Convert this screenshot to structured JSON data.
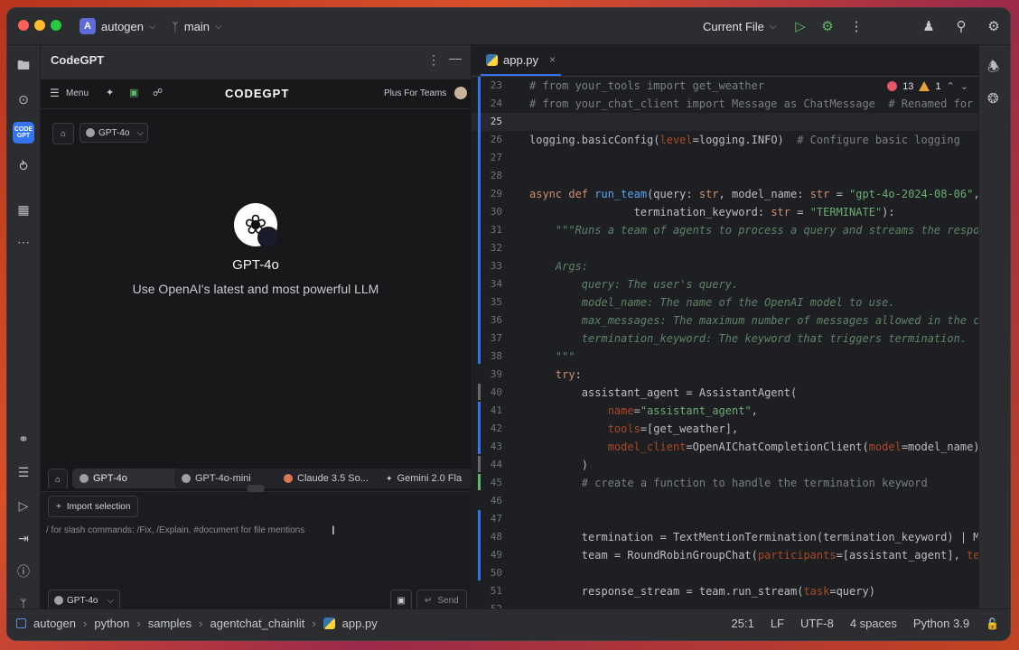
{
  "titlebar": {
    "project_badge": "A",
    "project_name": "autogen",
    "branch": "main",
    "run_config": "Current File"
  },
  "panel": {
    "title": "CodeGPT",
    "menu_label": "Menu",
    "logo": "CODEGPT",
    "plus_label": "Plus For Teams",
    "model_selector": "GPT-4o",
    "model_title": "GPT-4o",
    "model_subtitle": "Use OpenAI's latest and most powerful LLM",
    "chips": [
      "GPT-4o",
      "GPT-4o-mini",
      "Claude 3.5 So...",
      "Gemini 2.0 Fla"
    ],
    "import_selection": "Import selection",
    "input_placeholder": "/ for slash commands: /Fix, /Explain. #document for file mentions",
    "bottom_model": "GPT-4o",
    "send_label": "Send"
  },
  "editor": {
    "tab": "app.py",
    "errors": "13",
    "warnings": "1",
    "lines": [
      {
        "n": "23",
        "html": "<span class='cm'># from your_tools import get_weather</span>"
      },
      {
        "n": "24",
        "html": "<span class='cm'># from your_chat_client import Message as ChatMessage  # Renamed for c</span>"
      },
      {
        "n": "25",
        "html": ""
      },
      {
        "n": "26",
        "html": "logging.basicConfig(<span class='pa'>level</span>=logging.INFO)  <span class='cm'># Configure basic logging</span>"
      },
      {
        "n": "27",
        "html": ""
      },
      {
        "n": "28",
        "html": ""
      },
      {
        "n": "29",
        "html": "<span class='kw'>async def</span> <span class='fn'>run_team</span>(query: <span class='kw'>str</span>, model_name: <span class='kw'>str</span> = <span class='st'>\"gpt-4o-2024-08-06\"</span>,"
      },
      {
        "n": "30",
        "html": "                termination_keyword: <span class='kw'>str</span> = <span class='st'>\"TERMINATE\"</span>):"
      },
      {
        "n": "31",
        "html": "    <span class='ds'>\"\"\"Runs a team of agents to process a query and streams the respon</span>"
      },
      {
        "n": "32",
        "html": ""
      },
      {
        "n": "33",
        "html": "    <span class='ds'>Args:</span>"
      },
      {
        "n": "34",
        "html": "        <span class='ds'>query: The user's query.</span>"
      },
      {
        "n": "35",
        "html": "        <span class='ds'>model_name: The name of the OpenAI model to use.</span>"
      },
      {
        "n": "36",
        "html": "        <span class='ds'>max_messages: The maximum number of messages allowed in the co</span>"
      },
      {
        "n": "37",
        "html": "        <span class='ds'>termination_keyword: The keyword that triggers termination.</span>"
      },
      {
        "n": "38",
        "html": "    <span class='ds'>\"\"\"</span>"
      },
      {
        "n": "39",
        "html": "    <span class='kw'>try</span>:"
      },
      {
        "n": "40",
        "html": "        assistant_agent = AssistantAgent("
      },
      {
        "n": "41",
        "html": "            <span class='pa'>name</span>=<span class='st'>\"assistant_agent\"</span>,"
      },
      {
        "n": "42",
        "html": "            <span class='pa'>tools</span>=[get_weather],"
      },
      {
        "n": "43",
        "html": "            <span class='pa'>model_client</span>=OpenAIChatCompletionClient(<span class='pa'>model</span>=model_name)"
      },
      {
        "n": "44",
        "html": "        )"
      },
      {
        "n": "45",
        "html": "        <span class='cm'># create a function to handle the termination keyword</span>"
      },
      {
        "n": "46",
        "html": ""
      },
      {
        "n": "47",
        "html": ""
      },
      {
        "n": "48",
        "html": "        termination = TextMentionTermination(termination_keyword) | Ma"
      },
      {
        "n": "49",
        "html": "        team = RoundRobinGroupChat(<span class='pa'>participants</span>=[assistant_agent], <span class='pa'>ter</span>"
      },
      {
        "n": "50",
        "html": ""
      },
      {
        "n": "51",
        "html": "        response_stream = team.run_stream(<span class='pa'>task</span>=query)"
      },
      {
        "n": "52",
        "html": ""
      }
    ]
  },
  "status": {
    "crumbs": [
      "autogen",
      "python",
      "samples",
      "agentchat_chainlit",
      "app.py"
    ],
    "position": "25:1",
    "line_sep": "LF",
    "encoding": "UTF-8",
    "indent": "4 spaces",
    "interpreter": "Python 3.9"
  }
}
